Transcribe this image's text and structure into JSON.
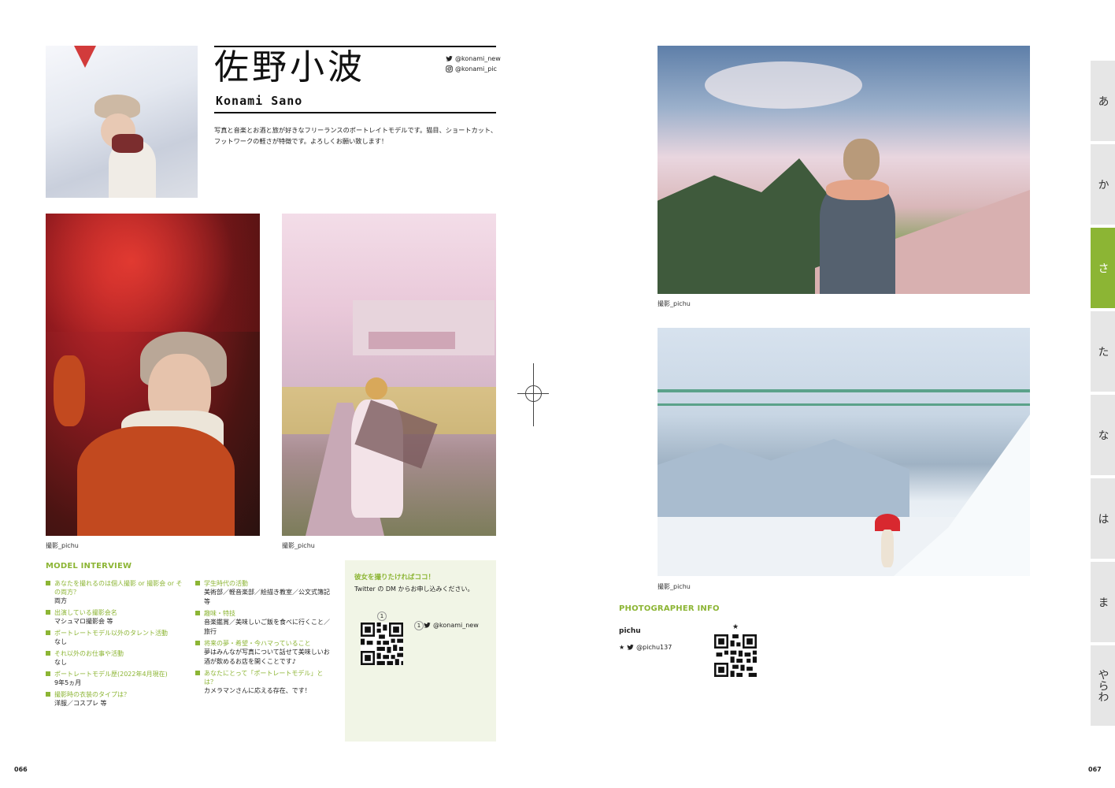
{
  "profile": {
    "name_jp": "佐野小波",
    "name_en": "Konami  Sano",
    "twitter": "@konami_new",
    "instagram": "@konami_pic",
    "bio": "写真と音楽とお酒と旅が好きなフリーランスのポートレイトモデルです。猫目、ショートカット、フットワークの軽さが特徴です。よろしくお願い致します！"
  },
  "captions": {
    "maple": "撮影_pichu",
    "sakura": "撮影_pichu",
    "mountain": "撮影_pichu",
    "snow": "撮影_pichu"
  },
  "interview": {
    "heading": "MODEL INTERVIEW",
    "left": [
      {
        "q": "あなたを撮れるのは個人撮影 or 撮影会 or その両方？",
        "a": "両方"
      },
      {
        "q": "出演している撮影会名",
        "a": "マシュマロ撮影会 等"
      },
      {
        "q": "ポートレートモデル以外のタレント活動",
        "a": "なし"
      },
      {
        "q": "それ以外のお仕事や活動",
        "a": "なし"
      },
      {
        "q": "ポートレートモデル歴(2022年4月現在)",
        "a": "9年5ヵ月"
      },
      {
        "q": "撮影時の衣装のタイプは？",
        "a": "洋服／コスプレ 等"
      }
    ],
    "right": [
      {
        "q": "学生時代の活動",
        "a": "美術部／軽音楽部／絵描き教室／公文式簿記等"
      },
      {
        "q": "趣味・特技",
        "a": "音楽鑑賞／美味しいご飯を食べに行くこと／旅行"
      },
      {
        "q": "将来の夢・希望・今ハマっていること",
        "a": "夢はみんなが写真について話せて美味しいお酒が飲めるお店を開くことです♪"
      },
      {
        "q": "あなたにとって「ポートレートモデル」とは？",
        "a": "カメラマンさんに応える存在、です！"
      }
    ]
  },
  "booking": {
    "title": "彼女を撮りたければココ！",
    "text": "Twitter の DM からお申し込みください。",
    "qr_num": "1",
    "handle": "@konami_new"
  },
  "photographer": {
    "heading": "PHOTOGRAPHER INFO",
    "name": "pichu",
    "mark": "★",
    "handle": "@pichu137"
  },
  "tabs": [
    "あ",
    "か",
    "さ",
    "た",
    "な",
    "は",
    "ま",
    "やらわ"
  ],
  "active_tab": "さ",
  "pages": {
    "left": "066",
    "right": "067"
  },
  "colors": {
    "accent": "#8cb534"
  }
}
